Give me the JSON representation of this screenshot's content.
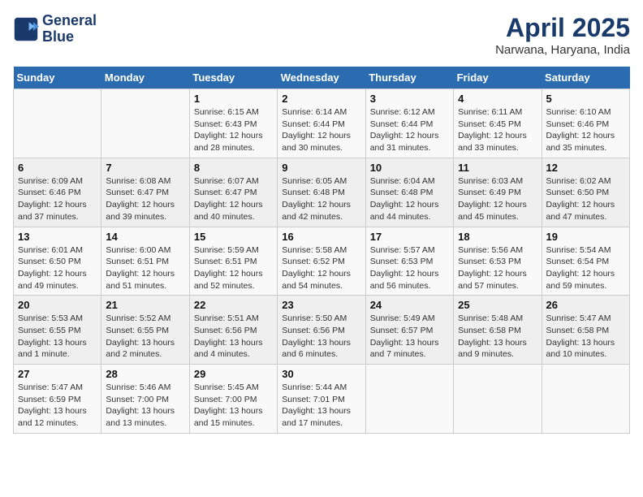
{
  "header": {
    "logo_line1": "General",
    "logo_line2": "Blue",
    "month": "April 2025",
    "location": "Narwana, Haryana, India"
  },
  "weekdays": [
    "Sunday",
    "Monday",
    "Tuesday",
    "Wednesday",
    "Thursday",
    "Friday",
    "Saturday"
  ],
  "weeks": [
    [
      {
        "day": "",
        "info": ""
      },
      {
        "day": "",
        "info": ""
      },
      {
        "day": "1",
        "info": "Sunrise: 6:15 AM\nSunset: 6:43 PM\nDaylight: 12 hours and 28 minutes."
      },
      {
        "day": "2",
        "info": "Sunrise: 6:14 AM\nSunset: 6:44 PM\nDaylight: 12 hours and 30 minutes."
      },
      {
        "day": "3",
        "info": "Sunrise: 6:12 AM\nSunset: 6:44 PM\nDaylight: 12 hours and 31 minutes."
      },
      {
        "day": "4",
        "info": "Sunrise: 6:11 AM\nSunset: 6:45 PM\nDaylight: 12 hours and 33 minutes."
      },
      {
        "day": "5",
        "info": "Sunrise: 6:10 AM\nSunset: 6:46 PM\nDaylight: 12 hours and 35 minutes."
      }
    ],
    [
      {
        "day": "6",
        "info": "Sunrise: 6:09 AM\nSunset: 6:46 PM\nDaylight: 12 hours and 37 minutes."
      },
      {
        "day": "7",
        "info": "Sunrise: 6:08 AM\nSunset: 6:47 PM\nDaylight: 12 hours and 39 minutes."
      },
      {
        "day": "8",
        "info": "Sunrise: 6:07 AM\nSunset: 6:47 PM\nDaylight: 12 hours and 40 minutes."
      },
      {
        "day": "9",
        "info": "Sunrise: 6:05 AM\nSunset: 6:48 PM\nDaylight: 12 hours and 42 minutes."
      },
      {
        "day": "10",
        "info": "Sunrise: 6:04 AM\nSunset: 6:48 PM\nDaylight: 12 hours and 44 minutes."
      },
      {
        "day": "11",
        "info": "Sunrise: 6:03 AM\nSunset: 6:49 PM\nDaylight: 12 hours and 45 minutes."
      },
      {
        "day": "12",
        "info": "Sunrise: 6:02 AM\nSunset: 6:50 PM\nDaylight: 12 hours and 47 minutes."
      }
    ],
    [
      {
        "day": "13",
        "info": "Sunrise: 6:01 AM\nSunset: 6:50 PM\nDaylight: 12 hours and 49 minutes."
      },
      {
        "day": "14",
        "info": "Sunrise: 6:00 AM\nSunset: 6:51 PM\nDaylight: 12 hours and 51 minutes."
      },
      {
        "day": "15",
        "info": "Sunrise: 5:59 AM\nSunset: 6:51 PM\nDaylight: 12 hours and 52 minutes."
      },
      {
        "day": "16",
        "info": "Sunrise: 5:58 AM\nSunset: 6:52 PM\nDaylight: 12 hours and 54 minutes."
      },
      {
        "day": "17",
        "info": "Sunrise: 5:57 AM\nSunset: 6:53 PM\nDaylight: 12 hours and 56 minutes."
      },
      {
        "day": "18",
        "info": "Sunrise: 5:56 AM\nSunset: 6:53 PM\nDaylight: 12 hours and 57 minutes."
      },
      {
        "day": "19",
        "info": "Sunrise: 5:54 AM\nSunset: 6:54 PM\nDaylight: 12 hours and 59 minutes."
      }
    ],
    [
      {
        "day": "20",
        "info": "Sunrise: 5:53 AM\nSunset: 6:55 PM\nDaylight: 13 hours and 1 minute."
      },
      {
        "day": "21",
        "info": "Sunrise: 5:52 AM\nSunset: 6:55 PM\nDaylight: 13 hours and 2 minutes."
      },
      {
        "day": "22",
        "info": "Sunrise: 5:51 AM\nSunset: 6:56 PM\nDaylight: 13 hours and 4 minutes."
      },
      {
        "day": "23",
        "info": "Sunrise: 5:50 AM\nSunset: 6:56 PM\nDaylight: 13 hours and 6 minutes."
      },
      {
        "day": "24",
        "info": "Sunrise: 5:49 AM\nSunset: 6:57 PM\nDaylight: 13 hours and 7 minutes."
      },
      {
        "day": "25",
        "info": "Sunrise: 5:48 AM\nSunset: 6:58 PM\nDaylight: 13 hours and 9 minutes."
      },
      {
        "day": "26",
        "info": "Sunrise: 5:47 AM\nSunset: 6:58 PM\nDaylight: 13 hours and 10 minutes."
      }
    ],
    [
      {
        "day": "27",
        "info": "Sunrise: 5:47 AM\nSunset: 6:59 PM\nDaylight: 13 hours and 12 minutes."
      },
      {
        "day": "28",
        "info": "Sunrise: 5:46 AM\nSunset: 7:00 PM\nDaylight: 13 hours and 13 minutes."
      },
      {
        "day": "29",
        "info": "Sunrise: 5:45 AM\nSunset: 7:00 PM\nDaylight: 13 hours and 15 minutes."
      },
      {
        "day": "30",
        "info": "Sunrise: 5:44 AM\nSunset: 7:01 PM\nDaylight: 13 hours and 17 minutes."
      },
      {
        "day": "",
        "info": ""
      },
      {
        "day": "",
        "info": ""
      },
      {
        "day": "",
        "info": ""
      }
    ]
  ]
}
